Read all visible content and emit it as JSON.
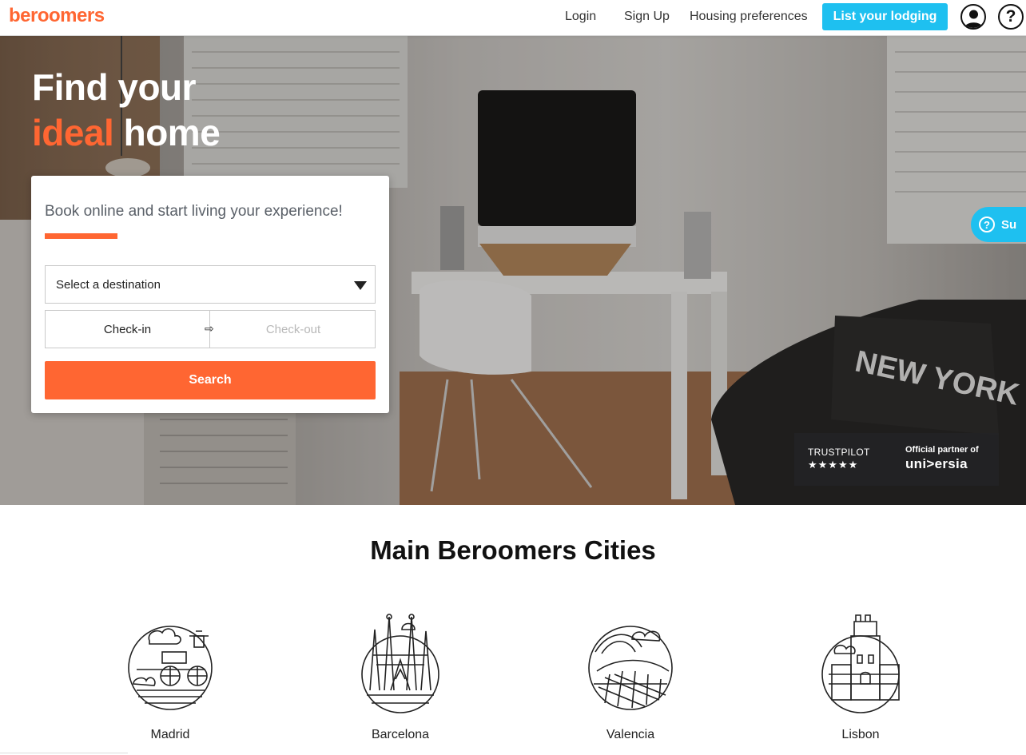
{
  "navbar": {
    "logo": "beroomers",
    "login": "Login",
    "signup": "Sign Up",
    "preferences": "Housing preferences",
    "cta": "List your lodging",
    "help_symbol": "?",
    "icons": [
      "user-icon",
      "help-icon"
    ]
  },
  "hero": {
    "title_line1": "Find your",
    "title_accent": "ideal",
    "title_line2_rest": " home",
    "search": {
      "tagline": "Book online and start living your experience!",
      "destination_placeholder": "Select a destination",
      "checkin": "Check-in",
      "arrow": "⇨",
      "checkout": "Check-out",
      "button": "Search"
    },
    "trust": {
      "trustpilot": "TRUSTPILOT",
      "stars": "★★★★★",
      "partner_label": "Official partner of",
      "partner_name": "uni>ersia"
    },
    "support_label": "Su",
    "support_symbol": "?",
    "pillow_text": "NEW YORK"
  },
  "cities": {
    "title": "Main Beroomers Cities",
    "items": [
      {
        "name": "Madrid",
        "icon": "madrid-illustration-icon"
      },
      {
        "name": "Barcelona",
        "icon": "barcelona-illustration-icon"
      },
      {
        "name": "Valencia",
        "icon": "valencia-illustration-icon"
      },
      {
        "name": "Lisbon",
        "icon": "lisbon-illustration-icon"
      }
    ]
  },
  "colors": {
    "brand_orange": "#ff6632",
    "cta_blue": "#1ec0f0",
    "text_dark": "#222222"
  }
}
